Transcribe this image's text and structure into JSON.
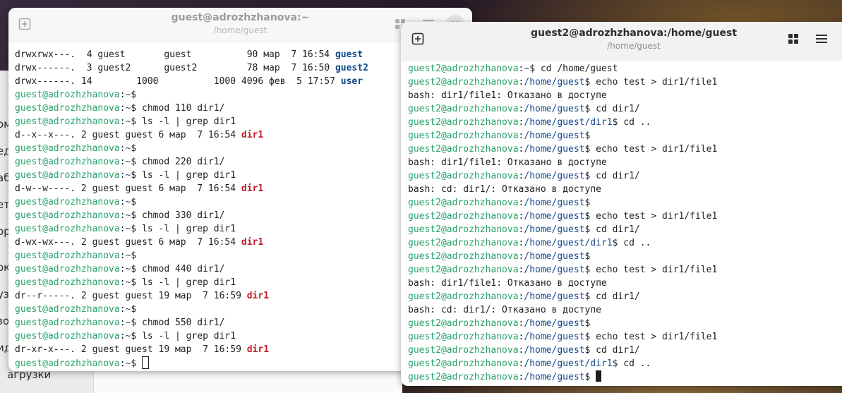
{
  "background_app": {
    "sidebar_items": [
      "ом",
      "ед",
      "аб",
      "ет",
      "ор",
      "ок",
      "уз",
      "зо",
      "ид",
      "агрузки"
    ]
  },
  "terminal1": {
    "title": "guest@adrozhzhanova:~",
    "subtitle": "/home/guest",
    "lines": [
      [
        {
          "t": "drwxrwx---.  4 guest       guest          90 мар  7 16:54 ",
          "c": ""
        },
        {
          "t": "guest",
          "c": "dirblue"
        }
      ],
      [
        {
          "t": "drwx------.  3 guest2      guest2         78 мар  7 16:50 ",
          "c": ""
        },
        {
          "t": "guest2",
          "c": "dirblue"
        }
      ],
      [
        {
          "t": "drwx------. 14        1000          1000 4096 фев  5 17:57 ",
          "c": ""
        },
        {
          "t": "user",
          "c": "dirblue"
        }
      ],
      [
        {
          "t": "guest@adrozhzhanova",
          "c": "p-user"
        },
        {
          "t": ":",
          "c": ""
        },
        {
          "t": "~",
          "c": "p-path"
        },
        {
          "t": "$",
          "c": ""
        }
      ],
      [
        {
          "t": "guest@adrozhzhanova",
          "c": "p-user"
        },
        {
          "t": ":",
          "c": ""
        },
        {
          "t": "~",
          "c": "p-path"
        },
        {
          "t": "$ chmod 110 dir1/",
          "c": ""
        }
      ],
      [
        {
          "t": "guest@adrozhzhanova",
          "c": "p-user"
        },
        {
          "t": ":",
          "c": ""
        },
        {
          "t": "~",
          "c": "p-path"
        },
        {
          "t": "$ ls -l | grep dir1",
          "c": ""
        }
      ],
      [
        {
          "t": "d--x--x---. 2 guest guest 6 мар  7 16:54 ",
          "c": ""
        },
        {
          "t": "dir1",
          "c": "dirred"
        }
      ],
      [
        {
          "t": "guest@adrozhzhanova",
          "c": "p-user"
        },
        {
          "t": ":",
          "c": ""
        },
        {
          "t": "~",
          "c": "p-path"
        },
        {
          "t": "$",
          "c": ""
        }
      ],
      [
        {
          "t": "guest@adrozhzhanova",
          "c": "p-user"
        },
        {
          "t": ":",
          "c": ""
        },
        {
          "t": "~",
          "c": "p-path"
        },
        {
          "t": "$ chmod 220 dir1/",
          "c": ""
        }
      ],
      [
        {
          "t": "guest@adrozhzhanova",
          "c": "p-user"
        },
        {
          "t": ":",
          "c": ""
        },
        {
          "t": "~",
          "c": "p-path"
        },
        {
          "t": "$ ls -l | grep dir1",
          "c": ""
        }
      ],
      [
        {
          "t": "d-w--w----. 2 guest guest 6 мар  7 16:54 ",
          "c": ""
        },
        {
          "t": "dir1",
          "c": "dirred"
        }
      ],
      [
        {
          "t": "guest@adrozhzhanova",
          "c": "p-user"
        },
        {
          "t": ":",
          "c": ""
        },
        {
          "t": "~",
          "c": "p-path"
        },
        {
          "t": "$",
          "c": ""
        }
      ],
      [
        {
          "t": "guest@adrozhzhanova",
          "c": "p-user"
        },
        {
          "t": ":",
          "c": ""
        },
        {
          "t": "~",
          "c": "p-path"
        },
        {
          "t": "$ chmod 330 dir1/",
          "c": ""
        }
      ],
      [
        {
          "t": "guest@adrozhzhanova",
          "c": "p-user"
        },
        {
          "t": ":",
          "c": ""
        },
        {
          "t": "~",
          "c": "p-path"
        },
        {
          "t": "$ ls -l | grep dir1",
          "c": ""
        }
      ],
      [
        {
          "t": "d-wx-wx---. 2 guest guest 6 мар  7 16:54 ",
          "c": ""
        },
        {
          "t": "dir1",
          "c": "dirred"
        }
      ],
      [
        {
          "t": "guest@adrozhzhanova",
          "c": "p-user"
        },
        {
          "t": ":",
          "c": ""
        },
        {
          "t": "~",
          "c": "p-path"
        },
        {
          "t": "$",
          "c": ""
        }
      ],
      [
        {
          "t": "guest@adrozhzhanova",
          "c": "p-user"
        },
        {
          "t": ":",
          "c": ""
        },
        {
          "t": "~",
          "c": "p-path"
        },
        {
          "t": "$ chmod 440 dir1/",
          "c": ""
        }
      ],
      [
        {
          "t": "guest@adrozhzhanova",
          "c": "p-user"
        },
        {
          "t": ":",
          "c": ""
        },
        {
          "t": "~",
          "c": "p-path"
        },
        {
          "t": "$ ls -l | grep dir1",
          "c": ""
        }
      ],
      [
        {
          "t": "dr--r-----. 2 guest guest 19 мар  7 16:59 ",
          "c": ""
        },
        {
          "t": "dir1",
          "c": "dirred"
        }
      ],
      [
        {
          "t": "guest@adrozhzhanova",
          "c": "p-user"
        },
        {
          "t": ":",
          "c": ""
        },
        {
          "t": "~",
          "c": "p-path"
        },
        {
          "t": "$",
          "c": ""
        }
      ],
      [
        {
          "t": "guest@adrozhzhanova",
          "c": "p-user"
        },
        {
          "t": ":",
          "c": ""
        },
        {
          "t": "~",
          "c": "p-path"
        },
        {
          "t": "$ chmod 550 dir1/",
          "c": ""
        }
      ],
      [
        {
          "t": "guest@adrozhzhanova",
          "c": "p-user"
        },
        {
          "t": ":",
          "c": ""
        },
        {
          "t": "~",
          "c": "p-path"
        },
        {
          "t": "$ ls -l | grep dir1",
          "c": ""
        }
      ],
      [
        {
          "t": "dr-xr-x---. 2 guest guest 19 мар  7 16:59 ",
          "c": ""
        },
        {
          "t": "dir1",
          "c": "dirred"
        }
      ],
      [
        {
          "t": "guest@adrozhzhanova",
          "c": "p-user"
        },
        {
          "t": ":",
          "c": ""
        },
        {
          "t": "~",
          "c": "p-path"
        },
        {
          "t": "$ ",
          "c": ""
        },
        {
          "t": "",
          "c": "cursor-outline"
        }
      ]
    ]
  },
  "terminal2": {
    "title": "guest2@adrozhzhanova:/home/guest",
    "subtitle": "/home/guest",
    "lines": [
      [
        {
          "t": "guest2@adrozhzhanova",
          "c": "p-user"
        },
        {
          "t": ":",
          "c": ""
        },
        {
          "t": "~",
          "c": "p-path"
        },
        {
          "t": "$ cd /home/guest",
          "c": ""
        }
      ],
      [
        {
          "t": "guest2@adrozhzhanova",
          "c": "p-user"
        },
        {
          "t": ":",
          "c": ""
        },
        {
          "t": "/home/guest",
          "c": "p-path"
        },
        {
          "t": "$ echo test > dir1/file1",
          "c": ""
        }
      ],
      [
        {
          "t": "bash: dir1/file1: Отказано в доступе",
          "c": ""
        }
      ],
      [
        {
          "t": "guest2@adrozhzhanova",
          "c": "p-user"
        },
        {
          "t": ":",
          "c": ""
        },
        {
          "t": "/home/guest",
          "c": "p-path"
        },
        {
          "t": "$ cd dir1/",
          "c": ""
        }
      ],
      [
        {
          "t": "guest2@adrozhzhanova",
          "c": "p-user"
        },
        {
          "t": ":",
          "c": ""
        },
        {
          "t": "/home/guest/dir1",
          "c": "p-path"
        },
        {
          "t": "$ cd ..",
          "c": ""
        }
      ],
      [
        {
          "t": "guest2@adrozhzhanova",
          "c": "p-user"
        },
        {
          "t": ":",
          "c": ""
        },
        {
          "t": "/home/guest",
          "c": "p-path"
        },
        {
          "t": "$",
          "c": ""
        }
      ],
      [
        {
          "t": "guest2@adrozhzhanova",
          "c": "p-user"
        },
        {
          "t": ":",
          "c": ""
        },
        {
          "t": "/home/guest",
          "c": "p-path"
        },
        {
          "t": "$ echo test > dir1/file1",
          "c": ""
        }
      ],
      [
        {
          "t": "bash: dir1/file1: Отказано в доступе",
          "c": ""
        }
      ],
      [
        {
          "t": "guest2@adrozhzhanova",
          "c": "p-user"
        },
        {
          "t": ":",
          "c": ""
        },
        {
          "t": "/home/guest",
          "c": "p-path"
        },
        {
          "t": "$ cd dir1/",
          "c": ""
        }
      ],
      [
        {
          "t": "bash: cd: dir1/: Отказано в доступе",
          "c": ""
        }
      ],
      [
        {
          "t": "guest2@adrozhzhanova",
          "c": "p-user"
        },
        {
          "t": ":",
          "c": ""
        },
        {
          "t": "/home/guest",
          "c": "p-path"
        },
        {
          "t": "$",
          "c": ""
        }
      ],
      [
        {
          "t": "guest2@adrozhzhanova",
          "c": "p-user"
        },
        {
          "t": ":",
          "c": ""
        },
        {
          "t": "/home/guest",
          "c": "p-path"
        },
        {
          "t": "$ echo test > dir1/file1",
          "c": ""
        }
      ],
      [
        {
          "t": "guest2@adrozhzhanova",
          "c": "p-user"
        },
        {
          "t": ":",
          "c": ""
        },
        {
          "t": "/home/guest",
          "c": "p-path"
        },
        {
          "t": "$ cd dir1/",
          "c": ""
        }
      ],
      [
        {
          "t": "guest2@adrozhzhanova",
          "c": "p-user"
        },
        {
          "t": ":",
          "c": ""
        },
        {
          "t": "/home/guest/dir1",
          "c": "p-path"
        },
        {
          "t": "$ cd ..",
          "c": ""
        }
      ],
      [
        {
          "t": "guest2@adrozhzhanova",
          "c": "p-user"
        },
        {
          "t": ":",
          "c": ""
        },
        {
          "t": "/home/guest",
          "c": "p-path"
        },
        {
          "t": "$",
          "c": ""
        }
      ],
      [
        {
          "t": "guest2@adrozhzhanova",
          "c": "p-user"
        },
        {
          "t": ":",
          "c": ""
        },
        {
          "t": "/home/guest",
          "c": "p-path"
        },
        {
          "t": "$ echo test > dir1/file1",
          "c": ""
        }
      ],
      [
        {
          "t": "bash: dir1/file1: Отказано в доступе",
          "c": ""
        }
      ],
      [
        {
          "t": "guest2@adrozhzhanova",
          "c": "p-user"
        },
        {
          "t": ":",
          "c": ""
        },
        {
          "t": "/home/guest",
          "c": "p-path"
        },
        {
          "t": "$ cd dir1/",
          "c": ""
        }
      ],
      [
        {
          "t": "bash: cd: dir1/: Отказано в доступе",
          "c": ""
        }
      ],
      [
        {
          "t": "guest2@adrozhzhanova",
          "c": "p-user"
        },
        {
          "t": ":",
          "c": ""
        },
        {
          "t": "/home/guest",
          "c": "p-path"
        },
        {
          "t": "$",
          "c": ""
        }
      ],
      [
        {
          "t": "guest2@adrozhzhanova",
          "c": "p-user"
        },
        {
          "t": ":",
          "c": ""
        },
        {
          "t": "/home/guest",
          "c": "p-path"
        },
        {
          "t": "$ echo test > dir1/file1",
          "c": ""
        }
      ],
      [
        {
          "t": "guest2@adrozhzhanova",
          "c": "p-user"
        },
        {
          "t": ":",
          "c": ""
        },
        {
          "t": "/home/guest",
          "c": "p-path"
        },
        {
          "t": "$ cd dir1/",
          "c": ""
        }
      ],
      [
        {
          "t": "guest2@adrozhzhanova",
          "c": "p-user"
        },
        {
          "t": ":",
          "c": ""
        },
        {
          "t": "/home/guest/dir1",
          "c": "p-path"
        },
        {
          "t": "$ cd ..",
          "c": ""
        }
      ],
      [
        {
          "t": "guest2@adrozhzhanova",
          "c": "p-user"
        },
        {
          "t": ":",
          "c": ""
        },
        {
          "t": "/home/guest",
          "c": "p-path"
        },
        {
          "t": "$ ",
          "c": ""
        },
        {
          "t": "",
          "c": "cursor-block"
        }
      ]
    ]
  },
  "icons": {
    "new_tab": "plus-in-square-icon",
    "tabs_overview": "grid-icon",
    "menu": "hamburger-menu-icon",
    "close": "close-icon"
  },
  "colors": {
    "prompt_user": "#26a269",
    "prompt_path": "#12488b",
    "dir_listing": "#12488b",
    "dir1_highlight": "#c01c28"
  }
}
